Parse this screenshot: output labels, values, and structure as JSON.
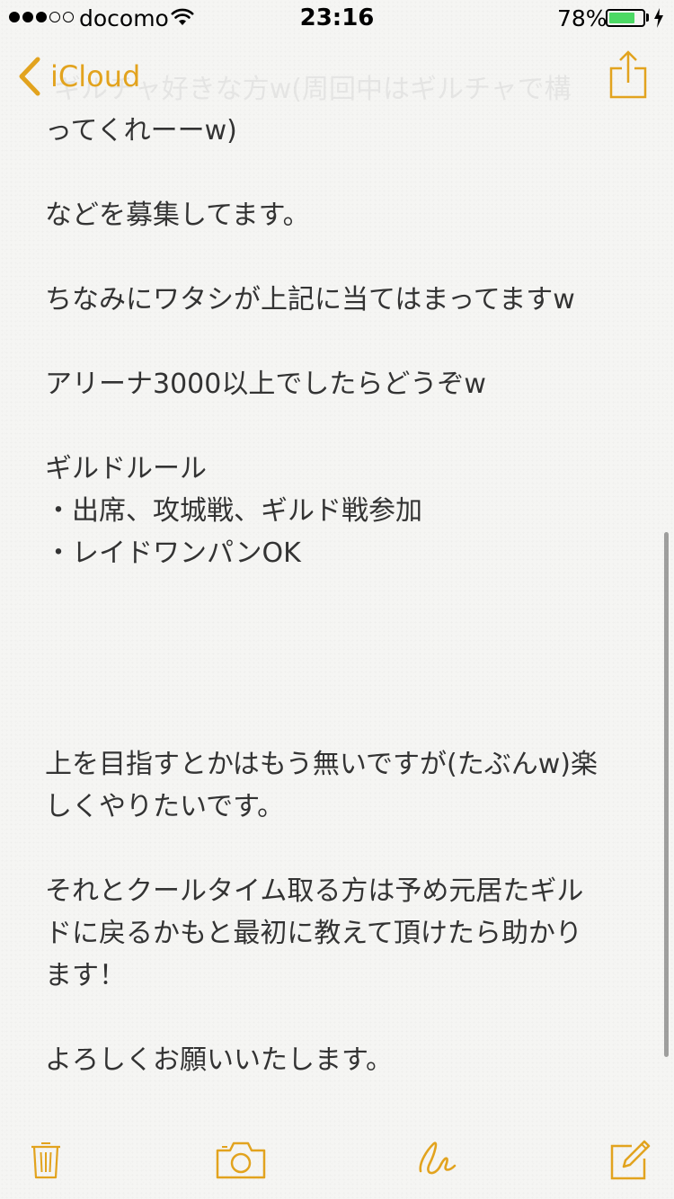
{
  "status_bar": {
    "carrier": "docomo",
    "time": "23:16",
    "battery_percent": "78%",
    "battery_level": 0.78,
    "signal_bars_filled": 3,
    "signal_bars_total": 5
  },
  "nav": {
    "back_label": "iCloud",
    "faded_text": "ギルチャ好きな方w(周回中はギルチャで構"
  },
  "note": {
    "lines": [
      "ってくれーーw)",
      "などを募集してます。",
      "ちなみにワタシが上記に当てはまってますw",
      "アリーナ3000以上でしたらどうぞw",
      "ギルドルール",
      "・出席、攻城戦、ギルド戦参加",
      "・レイドワンパンOK",
      "上を目指すとかはもう無いですが(たぶんw)楽",
      "しくやりたいです。",
      "それとクールタイム取る方は予め元居たギル",
      "ドに戻るかもと最初に教えて頂けたら助かり",
      "ます！",
      "よろしくお願いいたします。"
    ]
  },
  "colors": {
    "accent": "#e2a31e",
    "text": "#333333",
    "background": "#f5f5f3",
    "battery": "#4cd964"
  },
  "icons": {
    "back": "chevron-left-icon",
    "share": "share-icon",
    "trash": "trash-icon",
    "camera": "camera-icon",
    "sketch": "sketch-icon",
    "compose": "compose-icon"
  }
}
